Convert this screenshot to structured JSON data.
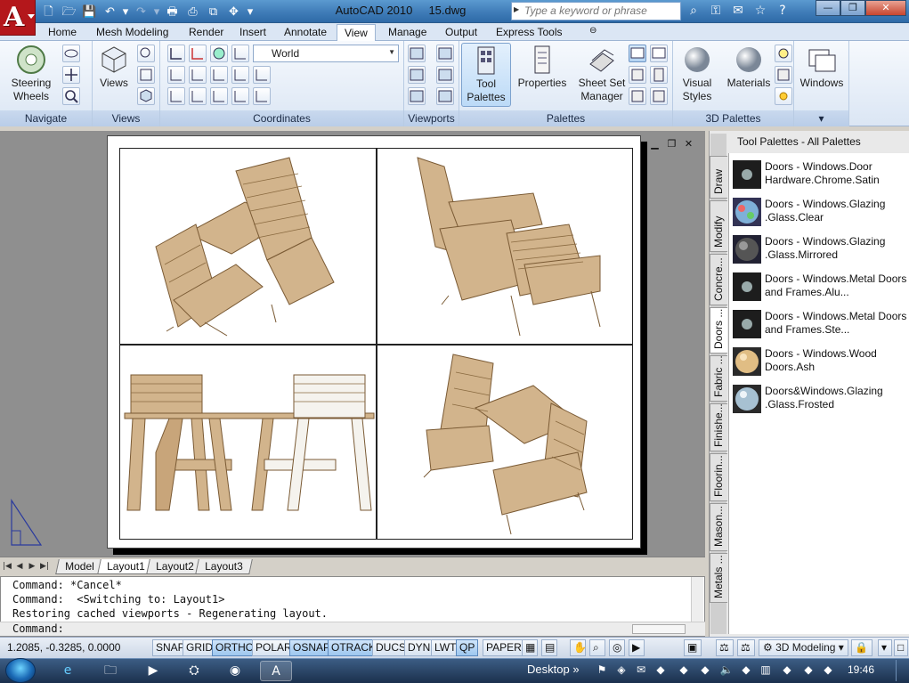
{
  "titlebar": {
    "app_title": "AutoCAD 2010",
    "file_name": "15.dwg",
    "search_placeholder": "Type a keyword or phrase",
    "window_controls": [
      "minimize",
      "restore",
      "close"
    ]
  },
  "ribbon_tabs": [
    {
      "label": "Home",
      "active": false
    },
    {
      "label": "Mesh Modeling",
      "active": false
    },
    {
      "label": "Render",
      "active": false
    },
    {
      "label": "Insert",
      "active": false
    },
    {
      "label": "Annotate",
      "active": false
    },
    {
      "label": "View",
      "active": true
    },
    {
      "label": "Manage",
      "active": false
    },
    {
      "label": "Output",
      "active": false
    },
    {
      "label": "Express Tools",
      "active": false
    }
  ],
  "ribbon": {
    "navigate": {
      "title": "Navigate",
      "steering_label": "Steering\nWheels"
    },
    "views": {
      "title": "Views",
      "views_label": "Views"
    },
    "coordinates": {
      "title": "Coordinates",
      "ucs_value": "World"
    },
    "viewports": {
      "title": "Viewports"
    },
    "palettes": {
      "title": "Palettes",
      "tool_palettes_label": "Tool\nPalettes",
      "properties_label": "Properties",
      "sheet_set_label": "Sheet Set\nManager"
    },
    "palettes3d": {
      "title": "3D Palettes",
      "visual_styles_label": "Visual\nStyles",
      "materials_label": "Materials"
    },
    "windows": {
      "windows_label": "Windows"
    }
  },
  "layout_tabs": [
    {
      "label": "Model",
      "active": false
    },
    {
      "label": "Layout1",
      "active": true
    },
    {
      "label": "Layout2",
      "active": false
    },
    {
      "label": "Layout3",
      "active": false
    }
  ],
  "command_history": [
    "Command: *Cancel*",
    "Command:  <Switching to: Layout1>",
    "Restoring cached viewports - Regenerating layout."
  ],
  "command_prompt": "Command:",
  "tool_palette": {
    "title": "Tool Palettes - All Palettes",
    "tabs": [
      {
        "label": "Draw",
        "active": false
      },
      {
        "label": "Modify",
        "active": false
      },
      {
        "label": "Concre...",
        "active": false
      },
      {
        "label": "Doors ...",
        "active": true
      },
      {
        "label": "Fabric ...",
        "active": false
      },
      {
        "label": "Finishe...",
        "active": false
      },
      {
        "label": "Floorin...",
        "active": false
      },
      {
        "label": "Mason...",
        "active": false
      },
      {
        "label": "Metals ...",
        "active": false
      }
    ],
    "items": [
      {
        "label": "Doors - Windows.Door Hardware.Chrome.Satin",
        "swatch": "dark-dot"
      },
      {
        "label": "Doors - Windows.Glazing .Glass.Clear",
        "swatch": "glass"
      },
      {
        "label": "Doors - Windows.Glazing .Glass.Mirrored",
        "swatch": "mirror"
      },
      {
        "label": "Doors - Windows.Metal Doors and Frames.Alu...",
        "swatch": "dark-dot"
      },
      {
        "label": "Doors - Windows.Metal Doors and Frames.Ste...",
        "swatch": "dark-dot"
      },
      {
        "label": "Doors - Windows.Wood Doors.Ash",
        "swatch": "ash"
      },
      {
        "label": "Doors&Windows.Glazing .Glass.Frosted",
        "swatch": "frosted"
      }
    ]
  },
  "statusbar": {
    "coordinates": "1.2085, -0.3285, 0.0000",
    "toggles": [
      {
        "label": "SNAP",
        "on": false
      },
      {
        "label": "GRID",
        "on": false
      },
      {
        "label": "ORTHO",
        "on": true
      },
      {
        "label": "POLAR",
        "on": false
      },
      {
        "label": "OSNAP",
        "on": true
      },
      {
        "label": "OTRACK",
        "on": true
      },
      {
        "label": "DUCS",
        "on": false
      },
      {
        "label": "DYN",
        "on": false
      },
      {
        "label": "LWT",
        "on": false
      },
      {
        "label": "QP",
        "on": true
      }
    ],
    "paper_label": "PAPER",
    "workspace": "3D Modeling"
  },
  "taskbar": {
    "desktop_label": "Desktop",
    "clock": "19:46"
  },
  "colors": {
    "wood": "#d2b48c",
    "wood_dark": "#a07c52",
    "ribbon_blue": "#dbe6f4",
    "title_blue": "#3f7cb8"
  }
}
